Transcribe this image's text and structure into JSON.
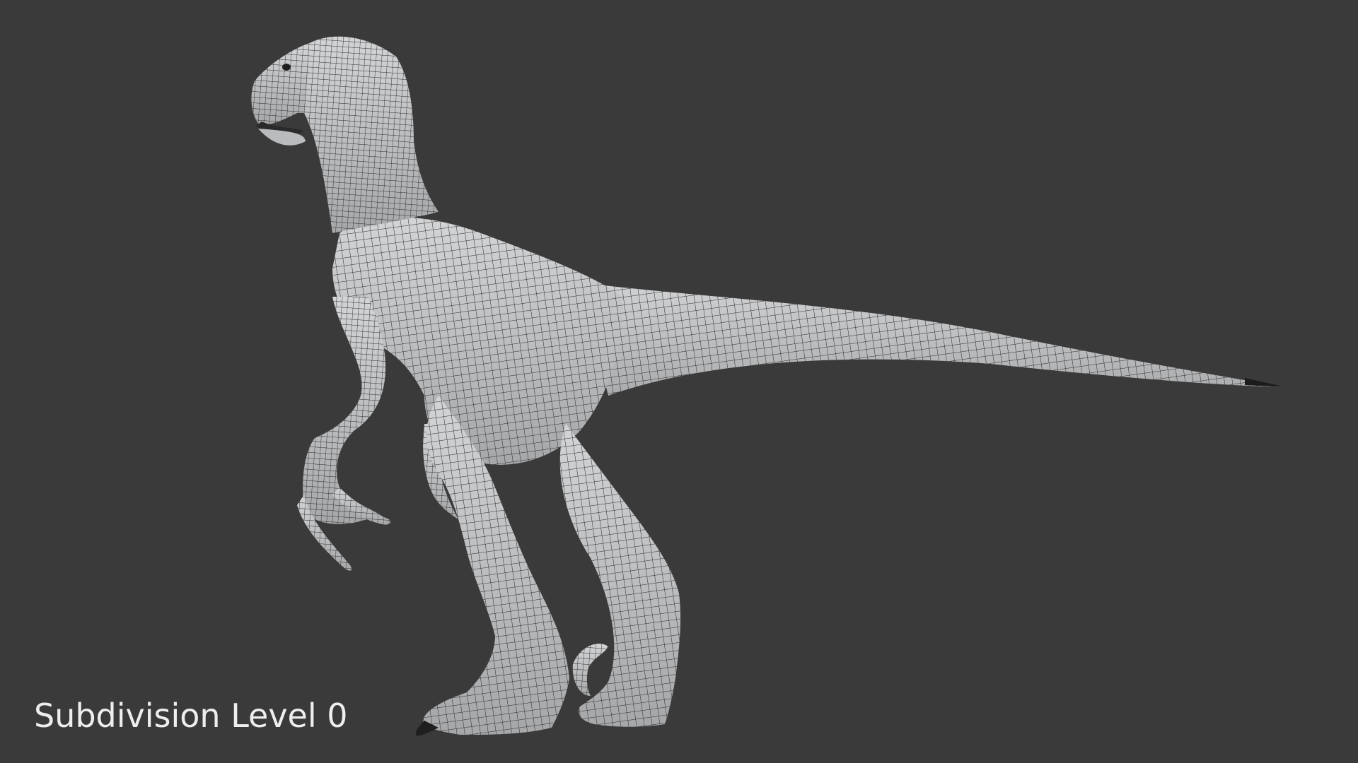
{
  "viewport": {
    "background_color": "#3a3a3a",
    "model_fill_color": "#bfc1c3",
    "wireframe_color": "#2a2a2a",
    "overlay_label": "Subdivision Level 0"
  }
}
